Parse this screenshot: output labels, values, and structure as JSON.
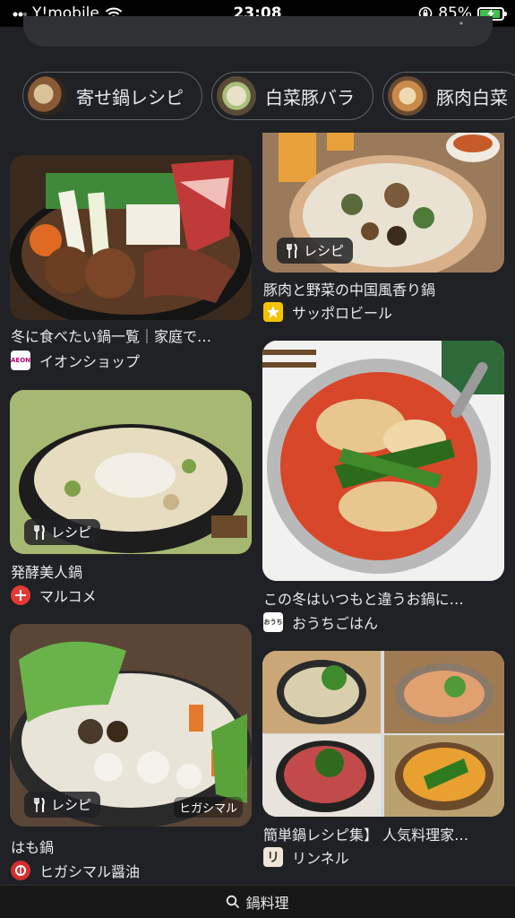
{
  "status": {
    "carrier": "Y!mobile",
    "time": "23:08",
    "battery": "85%",
    "battery_level": 0.85
  },
  "chips": [
    {
      "label": "寄せ鍋レシピ"
    },
    {
      "label": "白菜豚バラ"
    },
    {
      "label": "豚肉白菜"
    }
  ],
  "results": [
    {
      "title": "冬に食べたい鍋一覧｜家庭で…",
      "source": "イオンショップ",
      "badge": ""
    },
    {
      "title": "豚肉と野菜の中国風香り鍋",
      "source": "サッポロビール",
      "badge": "レシピ"
    },
    {
      "title": "発酵美人鍋",
      "source": "マルコメ",
      "badge": "レシピ"
    },
    {
      "title": "この冬はいつもと違うお鍋に…",
      "source": "おうちごはん",
      "badge": ""
    },
    {
      "title": "はも鍋",
      "source": "ヒガシマル醤油",
      "badge": "レシピ",
      "watermark": "ヒガシマル"
    },
    {
      "title": "簡単鍋レシピ集】 人気料理家…",
      "source": "リンネル",
      "badge": ""
    }
  ],
  "favicons": {
    "aeon": "AEON",
    "ouchi": "おうち"
  },
  "bottom_bar": {
    "query": "鍋料理"
  }
}
